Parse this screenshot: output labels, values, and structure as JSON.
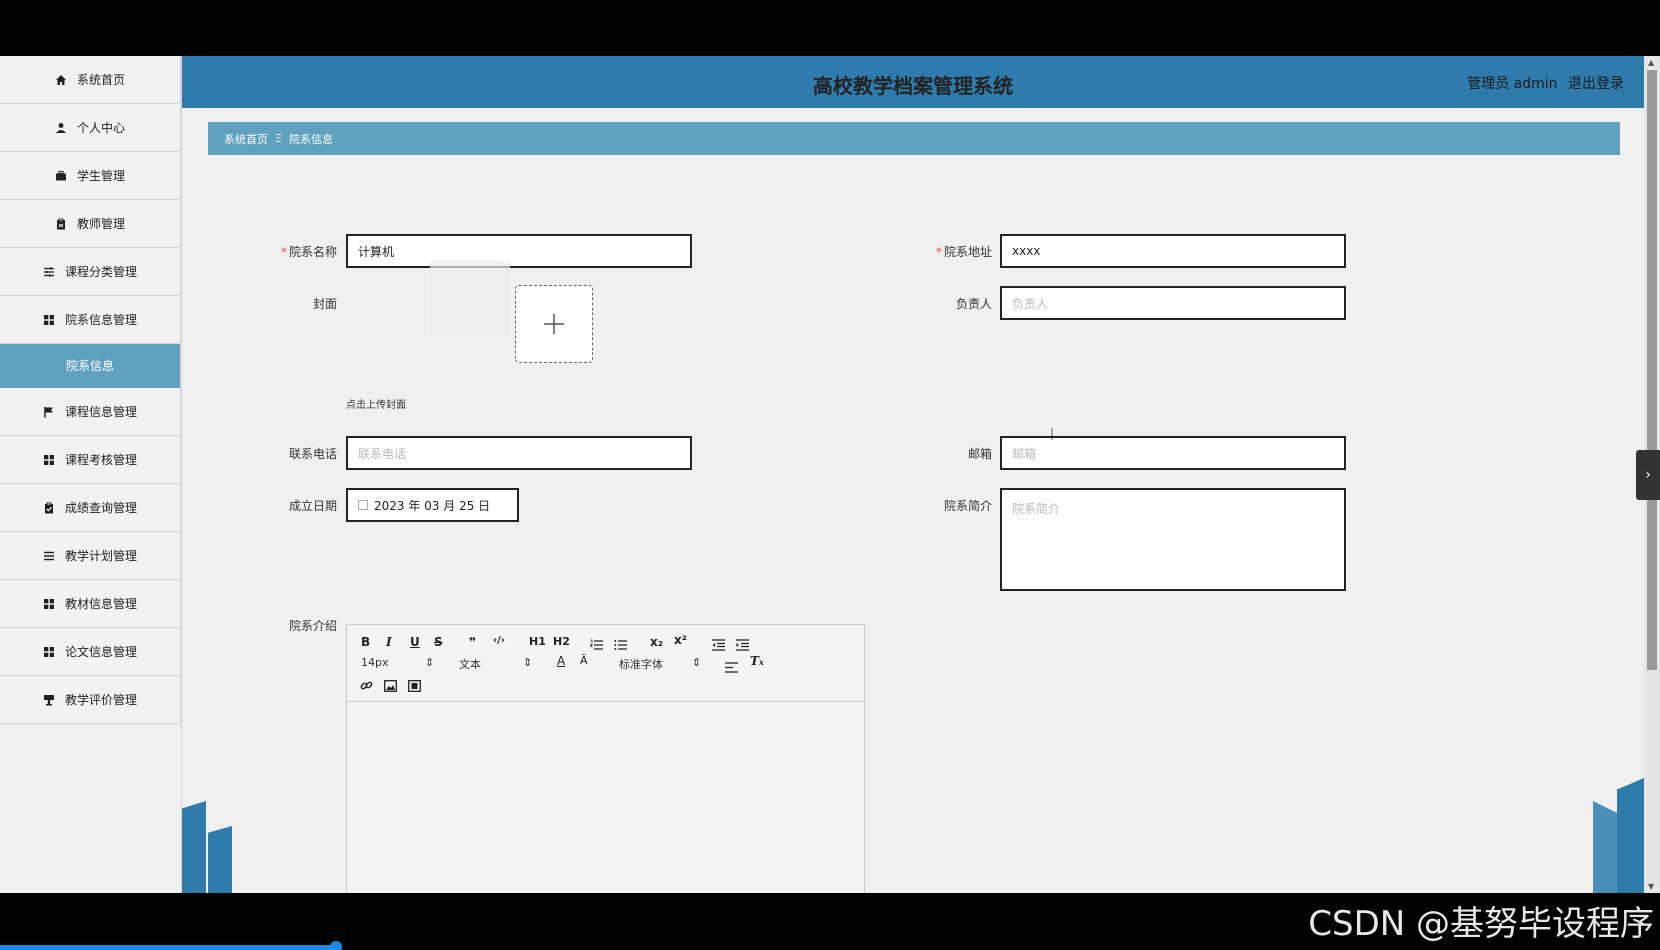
{
  "header": {
    "title": "高校教学档案管理系统",
    "user": "管理员 admin",
    "logout": "退出登录"
  },
  "sidebar": {
    "items": [
      {
        "label": "系统首页",
        "icon": "home-icon"
      },
      {
        "label": "个人中心",
        "icon": "user-icon"
      },
      {
        "label": "学生管理",
        "icon": "briefcase-icon"
      },
      {
        "label": "教师管理",
        "icon": "clipboard-icon"
      },
      {
        "label": "课程分类管理",
        "icon": "sliders-icon"
      },
      {
        "label": "院系信息管理",
        "icon": "grid-icon"
      },
      {
        "label": "院系信息",
        "icon": ""
      },
      {
        "label": "课程信息管理",
        "icon": "flag-icon"
      },
      {
        "label": "课程考核管理",
        "icon": "grid-icon"
      },
      {
        "label": "成绩查询管理",
        "icon": "clipboard-check-icon"
      },
      {
        "label": "教学计划管理",
        "icon": "list-icon"
      },
      {
        "label": "教材信息管理",
        "icon": "grid-icon"
      },
      {
        "label": "论文信息管理",
        "icon": "grid-icon"
      },
      {
        "label": "教学评价管理",
        "icon": "podium-icon"
      }
    ]
  },
  "breadcrumb": {
    "home": "系统首页",
    "separator": "Ξ",
    "current": "院系信息"
  },
  "form": {
    "name_label": "院系名称",
    "name_value": "计算机",
    "address_label": "院系地址",
    "address_value": "xxxx",
    "cover_label": "封面",
    "cover_hint": "点击上传封面",
    "manager_label": "负责人",
    "manager_placeholder": "负责人",
    "phone_label": "联系电话",
    "phone_placeholder": "联系电话",
    "email_label": "邮箱",
    "email_placeholder": "邮箱",
    "date_label": "成立日期",
    "date_value": "2023 年 03 月 25 日",
    "brief_label": "院系简介",
    "brief_placeholder": "院系简介",
    "intro_label": "院系介绍"
  },
  "editor": {
    "font_size": "14px",
    "header_select": "文本",
    "font_family": "标准字体",
    "buttons": [
      "B",
      "I",
      "U",
      "S",
      "❞",
      "‹/›",
      "H1",
      "H2",
      "ordered-list",
      "bullet-list",
      "x₂",
      "x²",
      "outdent",
      "indent"
    ]
  },
  "watermark": "CSDN @基努毕设程序"
}
